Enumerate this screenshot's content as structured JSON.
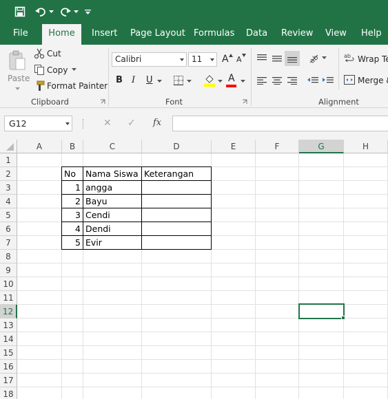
{
  "quick_access": {
    "save_icon": "save-icon",
    "undo_icon": "undo-icon",
    "redo_icon": "redo-icon",
    "customize_icon": "customize-qat-icon"
  },
  "tabs": [
    "File",
    "Home",
    "Insert",
    "Page Layout",
    "Formulas",
    "Data",
    "Review",
    "View",
    "Help"
  ],
  "active_tab": "Home",
  "clipboard": {
    "paste": "Paste",
    "cut": "Cut",
    "copy": "Copy",
    "format_painter": "Format Painter",
    "group_label": "Clipboard"
  },
  "font": {
    "name": "Calibri",
    "size": "11",
    "bold": "B",
    "italic": "I",
    "underline": "U",
    "grow": "A",
    "shrink": "A",
    "font_color_letter": "A",
    "font_color": "#ff0000",
    "highlight_color": "#ffff00",
    "group_label": "Font"
  },
  "alignment": {
    "wrap_text": "Wrap Te",
    "merge": "Merge &",
    "group_label": "Alignment"
  },
  "formula_bar": {
    "name_box": "G12",
    "cancel": "✕",
    "enter": "✓",
    "fx": "fx",
    "content": ""
  },
  "grid": {
    "columns": [
      "A",
      "B",
      "C",
      "D",
      "E",
      "F",
      "G",
      "H"
    ],
    "rows": [
      "1",
      "2",
      "3",
      "4",
      "5",
      "6",
      "7",
      "8",
      "9",
      "10",
      "11",
      "12",
      "13",
      "14",
      "15",
      "16",
      "17",
      "18"
    ],
    "selected_column": "G",
    "selected_row": "12"
  },
  "table": {
    "headers": [
      "No",
      "Nama Siswa",
      "Keterangan"
    ],
    "rows": [
      {
        "no": "1",
        "nama": "angga",
        "ket": ""
      },
      {
        "no": "2",
        "nama": "Bayu",
        "ket": ""
      },
      {
        "no": "3",
        "nama": "Cendi",
        "ket": ""
      },
      {
        "no": "4",
        "nama": "Dendi",
        "ket": ""
      },
      {
        "no": "5",
        "nama": "Evir",
        "ket": ""
      }
    ]
  },
  "colors": {
    "brand": "#217346",
    "ribbon_bg": "#f3f3f3",
    "gridline": "#e1e1e1"
  }
}
